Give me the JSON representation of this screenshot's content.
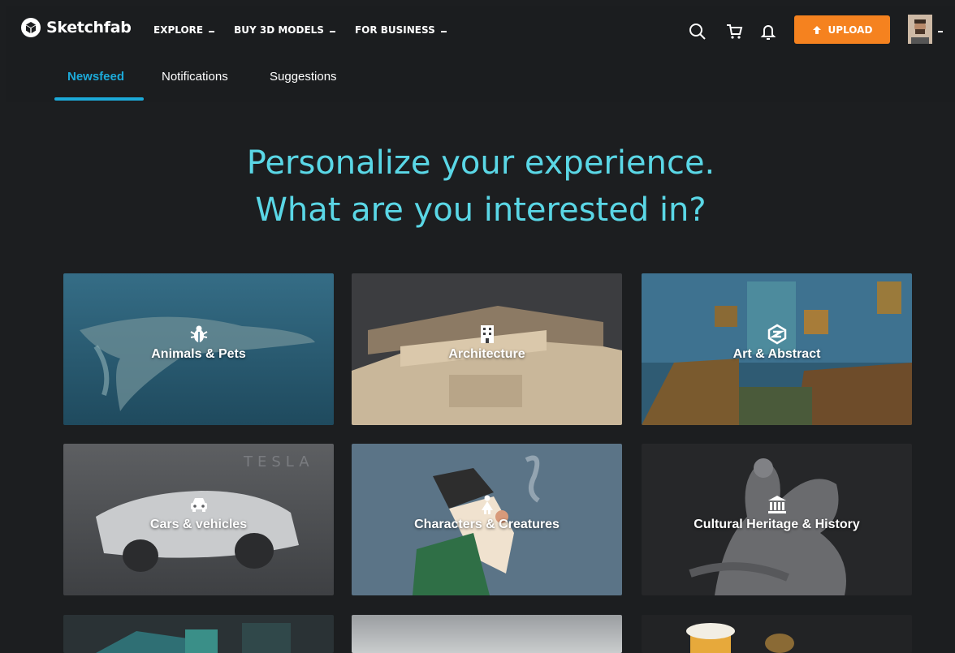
{
  "brand": {
    "name": "Sketchfab",
    "logo_icon": "sketchfab-logo-icon"
  },
  "nav": {
    "items": [
      {
        "label": "EXPLORE"
      },
      {
        "label": "BUY 3D MODELS"
      },
      {
        "label": "FOR BUSINESS"
      }
    ]
  },
  "toolbar": {
    "upload_label": "UPLOAD",
    "icons": [
      "search-icon",
      "cart-icon",
      "bell-icon",
      "upload-arrow-icon"
    ]
  },
  "subnav": {
    "tabs": [
      {
        "label": "Newsfeed",
        "active": true
      },
      {
        "label": "Notifications",
        "active": false
      },
      {
        "label": "Suggestions",
        "active": false
      }
    ]
  },
  "hero": {
    "line1": "Personalize your experience.",
    "line2": "What are you interested in?"
  },
  "categories": [
    {
      "label": "Animals & Pets",
      "icon": "bug-icon"
    },
    {
      "label": "Architecture",
      "icon": "building-icon"
    },
    {
      "label": "Art & Abstract",
      "icon": "abstract-art-icon"
    },
    {
      "label": "Cars & vehicles",
      "icon": "car-icon"
    },
    {
      "label": "Characters & Creatures",
      "icon": "person-icon"
    },
    {
      "label": "Cultural Heritage & History",
      "icon": "museum-icon"
    }
  ],
  "colors": {
    "accent": "#1caad9",
    "hero_text": "#5ad7e6",
    "upload": "#f5821f",
    "background": "#1c1e20"
  }
}
